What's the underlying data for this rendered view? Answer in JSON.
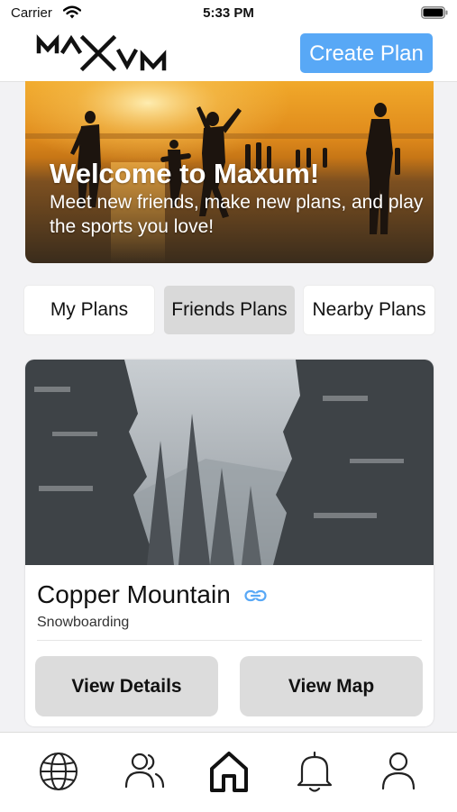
{
  "status_bar": {
    "carrier": "Carrier",
    "time": "5:33 PM"
  },
  "header": {
    "logo_text": "MAXUM",
    "create_plan_label": "Create Plan"
  },
  "hero": {
    "title": "Welcome to Maxum!",
    "subtitle": "Meet new friends, make new plans, and play the sports you love!"
  },
  "tabs": [
    {
      "label": "My Plans",
      "active": false
    },
    {
      "label": "Friends Plans",
      "active": true
    },
    {
      "label": "Nearby Plans",
      "active": false
    }
  ],
  "plan_card": {
    "title": "Copper Mountain",
    "sport": "Snowboarding",
    "view_details_label": "View Details",
    "view_map_label": "View Map"
  },
  "bottom_nav": {
    "items": [
      {
        "icon": "globe-icon"
      },
      {
        "icon": "friends-icon"
      },
      {
        "icon": "home-icon",
        "active": true
      },
      {
        "icon": "bell-icon"
      },
      {
        "icon": "profile-icon"
      }
    ]
  },
  "colors": {
    "accent": "#58a8f6",
    "active_tab": "#d9d9d9",
    "button_bg": "#dcdcdc"
  }
}
